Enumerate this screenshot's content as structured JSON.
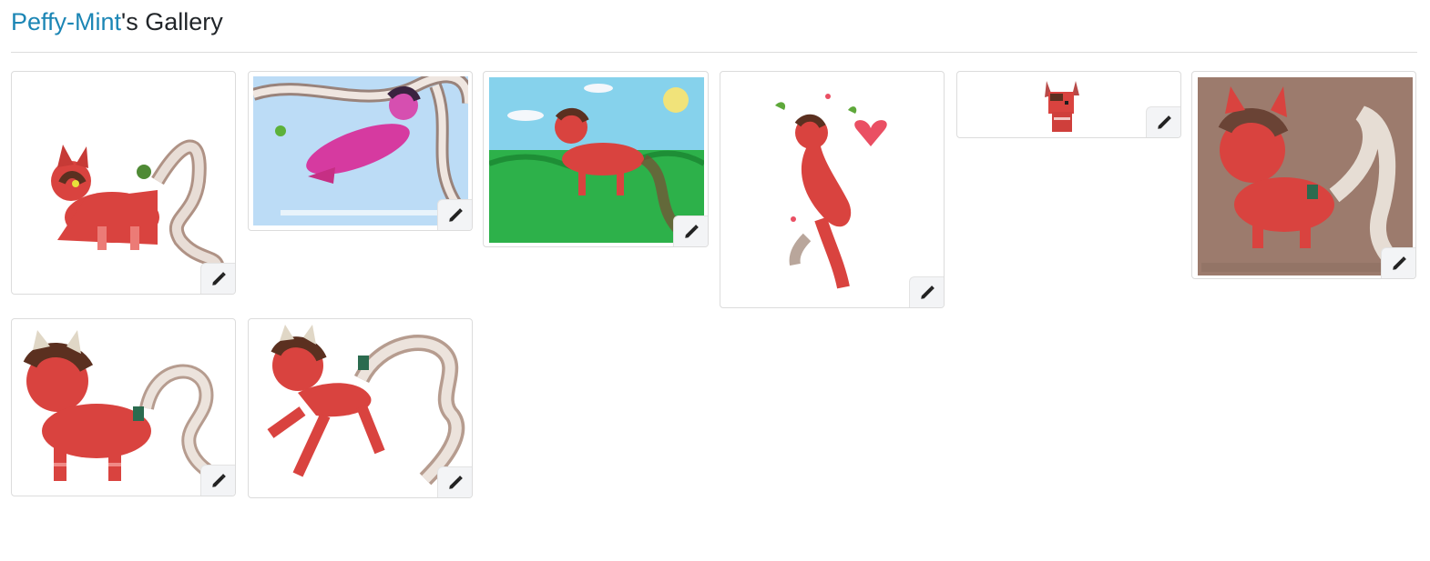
{
  "gallery": {
    "owner": "Peffy-Mint",
    "title_suffix": "'s Gallery"
  },
  "items": [
    {
      "palette": "cream",
      "edit_icon": "pencil-icon"
    },
    {
      "palette": "blue-sky",
      "edit_icon": "pencil-icon"
    },
    {
      "palette": "green-field",
      "edit_icon": "pencil-icon"
    },
    {
      "palette": "white-hearts",
      "edit_icon": "pencil-icon"
    },
    {
      "palette": "pixel",
      "edit_icon": "pencil-icon"
    },
    {
      "palette": "brown",
      "edit_icon": "pencil-icon"
    },
    {
      "palette": "white",
      "edit_icon": "pencil-icon"
    },
    {
      "palette": "white",
      "edit_icon": "pencil-icon"
    }
  ],
  "colors": {
    "link": "#1c86b5",
    "cat_red": "#d9433f",
    "sky": "#86d2ec",
    "grass": "#2db14a",
    "brown_bg": "#9c7b6d"
  }
}
